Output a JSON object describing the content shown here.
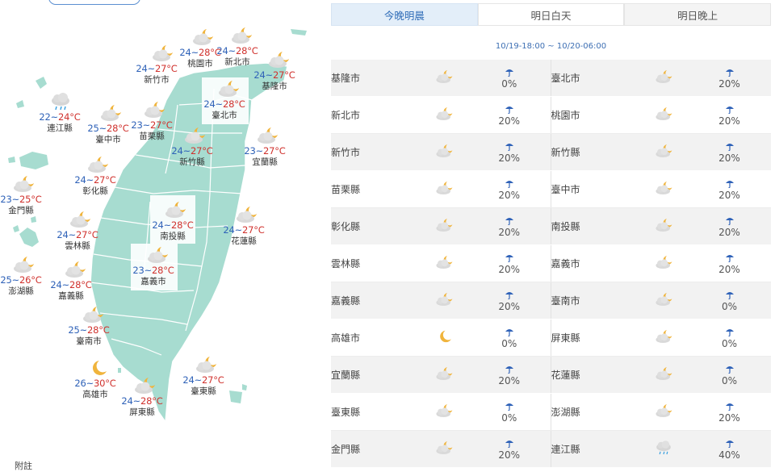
{
  "map": {
    "footnote": "附註",
    "cities": [
      {
        "name": "基隆市",
        "lo": "24",
        "hi": "27°C",
        "icon": "partly-cloudy-night-icon"
      },
      {
        "name": "新北市",
        "lo": "24",
        "hi": "28°C",
        "icon": "partly-cloudy-night-icon"
      },
      {
        "name": "桃園市",
        "lo": "24",
        "hi": "28°C",
        "icon": "partly-cloudy-night-icon"
      },
      {
        "name": "新竹市",
        "lo": "24",
        "hi": "27°C",
        "icon": "partly-cloudy-night-icon"
      },
      {
        "name": "臺北市",
        "lo": "24",
        "hi": "28°C",
        "icon": "partly-cloudy-night-icon"
      },
      {
        "name": "連江縣",
        "lo": "22",
        "hi": "24°C",
        "icon": "cloudy-rain-icon"
      },
      {
        "name": "臺中市",
        "lo": "25",
        "hi": "28°C",
        "icon": "partly-cloudy-night-icon"
      },
      {
        "name": "苗栗縣",
        "lo": "23",
        "hi": "27°C",
        "icon": "partly-cloudy-night-icon"
      },
      {
        "name": "新竹縣",
        "lo": "24",
        "hi": "27°C",
        "icon": "partly-cloudy-night-icon"
      },
      {
        "name": "宜蘭縣",
        "lo": "23",
        "hi": "27°C",
        "icon": "partly-cloudy-night-icon"
      },
      {
        "name": "彰化縣",
        "lo": "24",
        "hi": "27°C",
        "icon": "partly-cloudy-night-icon"
      },
      {
        "name": "金門縣",
        "lo": "23",
        "hi": "25°C",
        "icon": "partly-cloudy-night-icon"
      },
      {
        "name": "南投縣",
        "lo": "24",
        "hi": "28°C",
        "icon": "partly-cloudy-night-icon"
      },
      {
        "name": "花蓮縣",
        "lo": "24",
        "hi": "27°C",
        "icon": "partly-cloudy-night-icon"
      },
      {
        "name": "雲林縣",
        "lo": "24",
        "hi": "27°C",
        "icon": "partly-cloudy-night-icon"
      },
      {
        "name": "嘉義市",
        "lo": "23",
        "hi": "28°C",
        "icon": "partly-cloudy-night-icon"
      },
      {
        "name": "澎湖縣",
        "lo": "25",
        "hi": "26°C",
        "icon": "partly-cloudy-night-icon"
      },
      {
        "name": "嘉義縣",
        "lo": "24",
        "hi": "28°C",
        "icon": "partly-cloudy-night-icon"
      },
      {
        "name": "臺南市",
        "lo": "25",
        "hi": "28°C",
        "icon": "partly-cloudy-night-icon"
      },
      {
        "name": "高雄市",
        "lo": "26",
        "hi": "30°C",
        "icon": "moon-icon"
      },
      {
        "name": "臺東縣",
        "lo": "24",
        "hi": "27°C",
        "icon": "partly-cloudy-night-icon"
      },
      {
        "name": "屏東縣",
        "lo": "24",
        "hi": "28°C",
        "icon": "partly-cloudy-night-icon"
      }
    ]
  },
  "tabs": [
    {
      "label": "今晚明晨",
      "active": true
    },
    {
      "label": "明日白天",
      "active": false
    },
    {
      "label": "明日晚上",
      "active": false
    }
  ],
  "time_range": "10/19-18:00 ~ 10/20-06:00",
  "rows": [
    [
      {
        "city": "基隆市",
        "icon": "partly-cloudy-night-icon",
        "pop": "0%"
      },
      {
        "city": "臺北市",
        "icon": "partly-cloudy-night-icon",
        "pop": "20%"
      }
    ],
    [
      {
        "city": "新北市",
        "icon": "partly-cloudy-night-icon",
        "pop": "20%"
      },
      {
        "city": "桃園市",
        "icon": "partly-cloudy-night-icon",
        "pop": "20%"
      }
    ],
    [
      {
        "city": "新竹市",
        "icon": "partly-cloudy-night-icon",
        "pop": "20%"
      },
      {
        "city": "新竹縣",
        "icon": "partly-cloudy-night-icon",
        "pop": "20%"
      }
    ],
    [
      {
        "city": "苗栗縣",
        "icon": "partly-cloudy-night-icon",
        "pop": "20%"
      },
      {
        "city": "臺中市",
        "icon": "partly-cloudy-night-icon",
        "pop": "20%"
      }
    ],
    [
      {
        "city": "彰化縣",
        "icon": "partly-cloudy-night-icon",
        "pop": "20%"
      },
      {
        "city": "南投縣",
        "icon": "partly-cloudy-night-icon",
        "pop": "20%"
      }
    ],
    [
      {
        "city": "雲林縣",
        "icon": "partly-cloudy-night-icon",
        "pop": "20%"
      },
      {
        "city": "嘉義市",
        "icon": "partly-cloudy-night-icon",
        "pop": "20%"
      }
    ],
    [
      {
        "city": "嘉義縣",
        "icon": "partly-cloudy-night-icon",
        "pop": "20%"
      },
      {
        "city": "臺南市",
        "icon": "partly-cloudy-night-icon",
        "pop": "0%"
      }
    ],
    [
      {
        "city": "高雄市",
        "icon": "moon-icon",
        "pop": "0%"
      },
      {
        "city": "屏東縣",
        "icon": "partly-cloudy-night-icon",
        "pop": "0%"
      }
    ],
    [
      {
        "city": "宜蘭縣",
        "icon": "partly-cloudy-night-icon",
        "pop": "20%"
      },
      {
        "city": "花蓮縣",
        "icon": "partly-cloudy-night-icon",
        "pop": "0%"
      }
    ],
    [
      {
        "city": "臺東縣",
        "icon": "partly-cloudy-night-icon",
        "pop": "0%"
      },
      {
        "city": "澎湖縣",
        "icon": "partly-cloudy-night-icon",
        "pop": "20%"
      }
    ],
    [
      {
        "city": "金門縣",
        "icon": "partly-cloudy-night-icon",
        "pop": "20%"
      },
      {
        "city": "連江縣",
        "icon": "cloudy-rain-icon",
        "pop": "40%"
      }
    ]
  ],
  "colors": {
    "land": "#a7dcd0",
    "land_border": "#ffffff",
    "temp_low": "#2f62b8",
    "temp_high": "#d0312d",
    "tab_active_text": "#2d6bb7",
    "umbrella": "#2f62b8",
    "cloud": "#d8d8d8",
    "moon": "#f0b43c"
  }
}
